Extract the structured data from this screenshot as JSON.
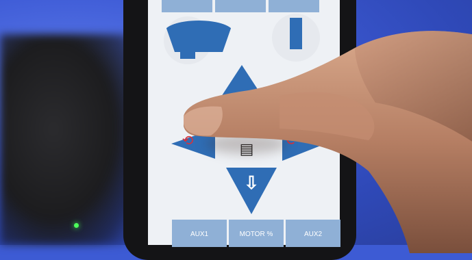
{
  "screen": {
    "top_buttons": [
      "",
      "",
      ""
    ],
    "icons": {
      "fan": "fan-icon",
      "bar": "bar-icon",
      "rotate_left": "rotate-ccw-icon",
      "rotate_right": "rotate-cw-icon",
      "document": "document-icon",
      "up": "arrow-up-icon",
      "down": "arrow-down-icon",
      "left": "arrow-left-icon",
      "right": "arrow-right-icon"
    },
    "bottom_buttons": {
      "aux1": "AUX1",
      "motor": "MOTOR %",
      "aux2": "AUX2"
    },
    "colors": {
      "accent": "#2f6db5",
      "button": "#8fb0d6",
      "rotate": "#d8323a",
      "backdrop": "#3e5bd6"
    }
  }
}
